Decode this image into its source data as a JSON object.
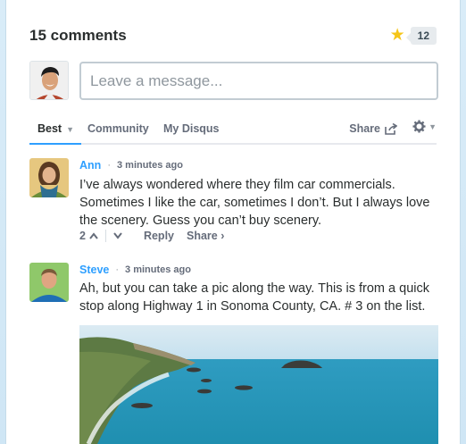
{
  "header": {
    "comment_count": "15 comments",
    "favorites": "12"
  },
  "composer": {
    "placeholder": "Leave a message..."
  },
  "tabs": {
    "best": "Best",
    "community": "Community",
    "my_disqus": "My Disqus",
    "share": "Share"
  },
  "comments": [
    {
      "author": "Ann",
      "time": "3 minutes ago",
      "lines": [
        "I’ve always wondered where they film car commercials.",
        "Sometimes I like the car, sometimes I don’t. But I always love",
        "the scenery. Guess you can’t buy scenery."
      ],
      "votes": "2",
      "reply": "Reply",
      "share": "Share ›"
    },
    {
      "author": "Steve",
      "time": "3 minutes ago",
      "lines": [
        "Ah, but you can take a pic along the way. This is from a quick",
        "stop along Highway 1 in Sonoma County, CA. # 3 on the list."
      ]
    }
  ],
  "separator": "·",
  "colors": {
    "accent": "#2e9fff",
    "star": "#f5c518",
    "text": "#2a2e2e",
    "muted": "#656c7a"
  },
  "icons": [
    "star-icon",
    "share-icon",
    "gear-icon",
    "upvote-icon",
    "downvote-icon",
    "chevron-down-icon"
  ]
}
